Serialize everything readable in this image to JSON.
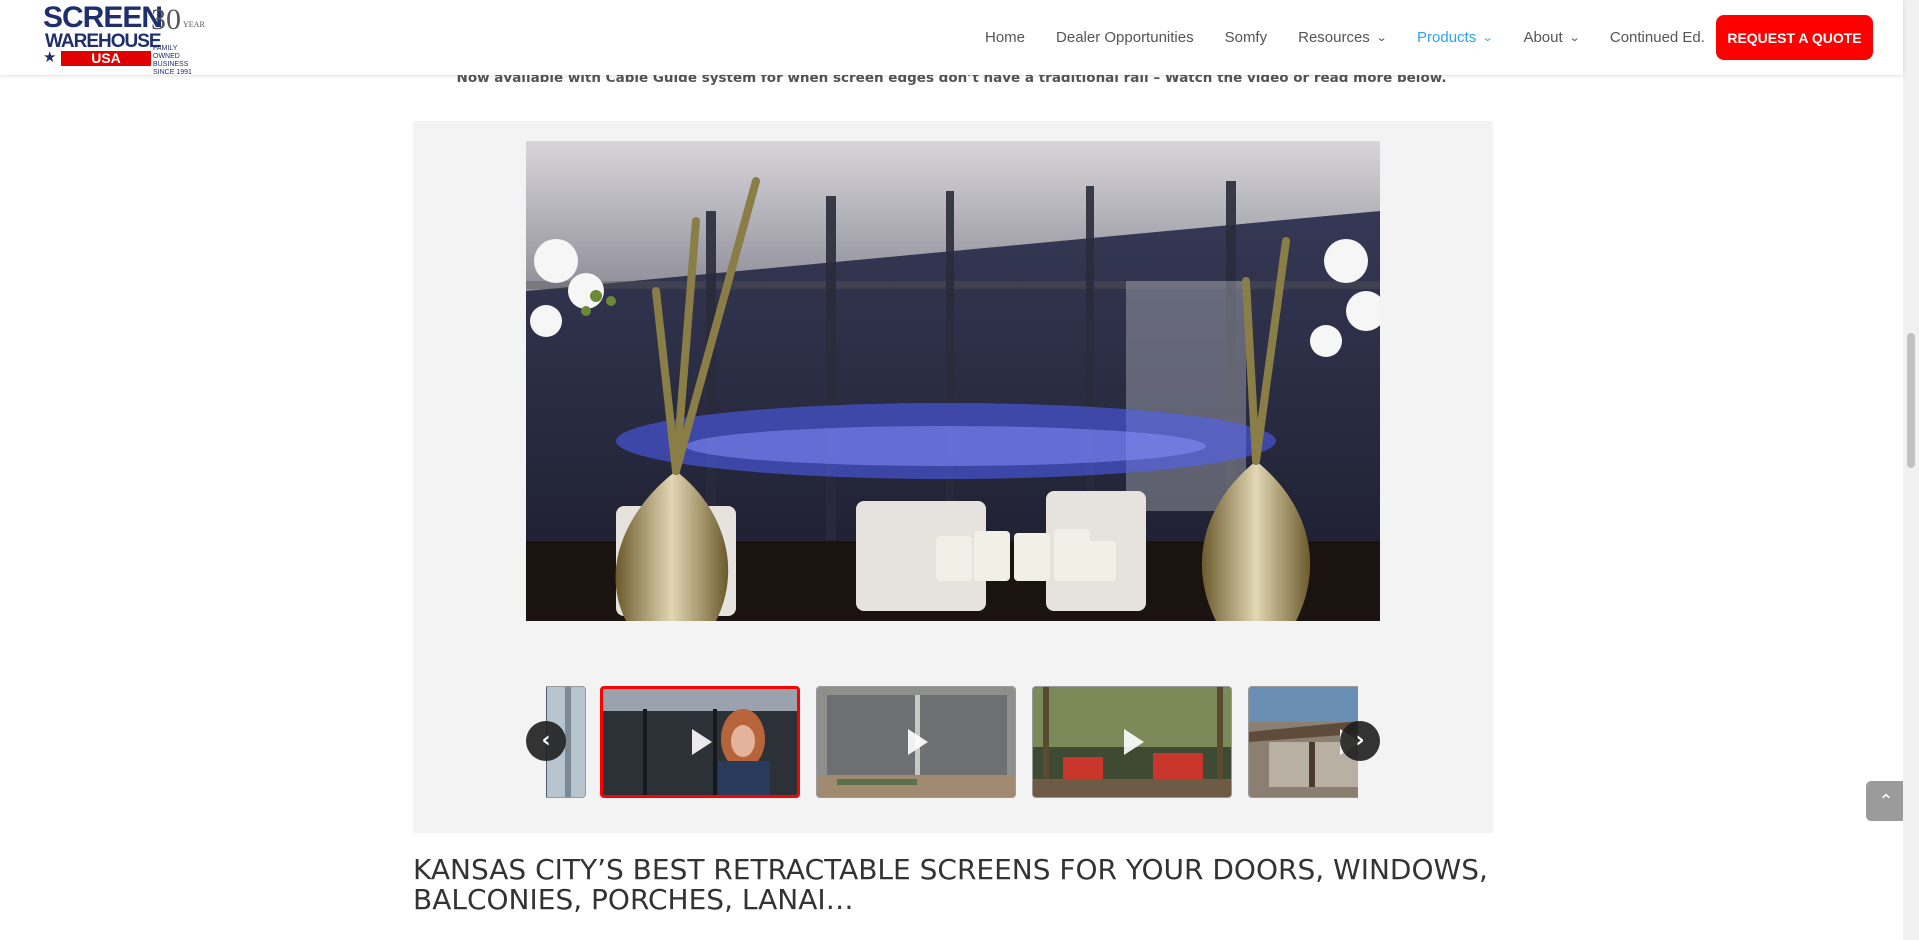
{
  "brand": {
    "logo_line1": "SCREEN",
    "logo_line2": "WAREHOUSE",
    "logo_line3": "USA",
    "logo_anniversary": "30",
    "logo_year": "YEAR",
    "logo_tagline": "FAMILY OWNED BUSINESS SINCE 1991",
    "accent_color": "#ff0000",
    "nav_active_color": "#2ea3f2"
  },
  "nav": {
    "items": [
      {
        "label": "Home"
      },
      {
        "label": "Dealer Opportunities"
      },
      {
        "label": "Somfy"
      },
      {
        "label": "Resources",
        "dropdown": true
      },
      {
        "label": "Products",
        "dropdown": true,
        "active": true
      },
      {
        "label": "About",
        "dropdown": true
      },
      {
        "label": "Continued Ed."
      }
    ],
    "cta_label": "REQUEST A QUOTE"
  },
  "notice": "Now available with Cable Guide system for when screen edges don’t have a traditional rail – Watch the video or read more below.",
  "gallery": {
    "prev_icon": "‹",
    "next_icon": "›",
    "thumbnails": [
      {
        "name": "partial-thumb"
      },
      {
        "name": "presenter-video",
        "active": true
      },
      {
        "name": "patio-screen-video"
      },
      {
        "name": "porch-furniture-video"
      },
      {
        "name": "pergola-video"
      }
    ]
  },
  "headline": "KANSAS CITY’S BEST RETRACTABLE SCREENS FOR YOUR DOORS, WINDOWS, BALCONIES, PORCHES, LANAI…",
  "back_to_top_icon": "chevron-up-icon"
}
